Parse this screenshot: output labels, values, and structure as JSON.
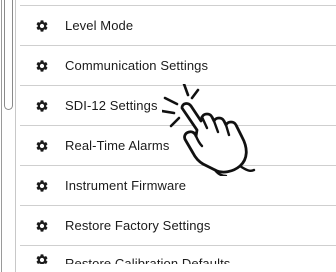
{
  "menu": {
    "items": [
      {
        "label": "Level Mode",
        "icon": "gear-icon"
      },
      {
        "label": "Communication Settings",
        "icon": "gear-icon"
      },
      {
        "label": "SDI-12 Settings",
        "icon": "gear-icon"
      },
      {
        "label": "Real-Time Alarms",
        "icon": "gear-icon"
      },
      {
        "label": "Instrument Firmware",
        "icon": "gear-icon"
      },
      {
        "label": "Restore Factory Settings",
        "icon": "gear-icon"
      },
      {
        "label": "Restore Calibration Defaults",
        "icon": "gear-icon"
      }
    ]
  },
  "overlay": {
    "icon": "tap-hand-icon",
    "target": "SDI-12 Settings"
  },
  "colors": {
    "text": "#1b1b1b",
    "divider": "#cfcfcf",
    "icon": "#1a1a1a",
    "background": "#ffffff"
  }
}
